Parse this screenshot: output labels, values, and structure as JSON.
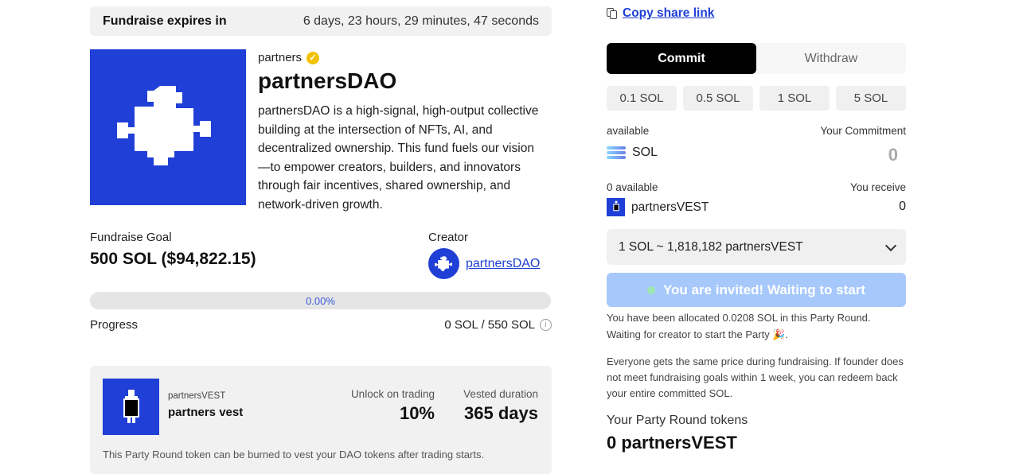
{
  "fundraise": {
    "expires_label": "Fundraise expires in",
    "expires_value": "6 days, 23 hours, 29 minutes, 47 seconds"
  },
  "project": {
    "owner": "partners",
    "name": "partnersDAO",
    "description": "partnersDAO is a high-signal, high-output collective building at the intersection of NFTs, AI, and decentralized ownership. This fund fuels our vision—to empower creators, builders, and innovators through fair incentives, shared ownership, and network-driven growth.",
    "goal_label": "Fundraise Goal",
    "goal_value": "500 SOL ($94,822.15)",
    "creator_label": "Creator",
    "creator_name": "partnersDAO",
    "progress_fraction": 0.0,
    "progress_percent": "0.00%",
    "progress_label": "Progress",
    "progress_value": "0 SOL / 550 SOL"
  },
  "vest": {
    "symbol": "partnersVEST",
    "name": "partners vest",
    "unlock_label": "Unlock on trading",
    "unlock_value": "10%",
    "vested_label": "Vested duration",
    "vested_value": "365 days",
    "note": "This Party Round token can be burned to vest your DAO tokens after trading starts."
  },
  "share": {
    "label": "Copy share link"
  },
  "trade": {
    "tabs": [
      "Commit",
      "Withdraw"
    ],
    "amounts": [
      "0.1 SOL",
      "0.5 SOL",
      "1 SOL",
      "5 SOL"
    ],
    "available_label": "available",
    "commitment_label": "Your Commitment",
    "sol_label": "SOL",
    "commitment_value": "0",
    "available2_label": "0 available",
    "receive_label": "You receive",
    "vest_token": "partnersVEST",
    "receive_value": "0",
    "rate": "1 SOL ~ 1,818,182 partnersVEST",
    "invite_button": "You are invited! Waiting to start",
    "alloc_note_1": "You have been allocated 0.0208 SOL in this Party Round.",
    "alloc_note_2": "Waiting for creator to start the Party 🎉.",
    "price_note": "Everyone gets the same price during fundraising. If founder does not meet fundraising goals within 1 week, you can redeem back your entire committed SOL.",
    "tokens_label": "Your Party Round tokens",
    "tokens_value": "0 partnersVEST"
  },
  "colors": {
    "brand_blue": "#1f3fd6",
    "invite_button": "#a6c8fb",
    "active_tab": "#000000"
  }
}
